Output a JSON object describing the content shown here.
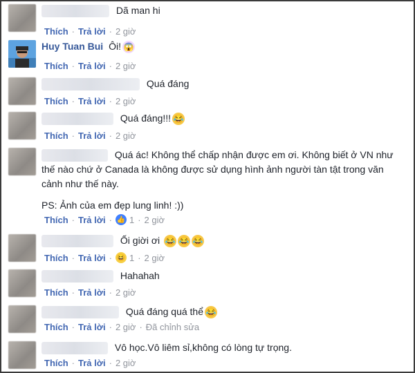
{
  "actions": {
    "like": "Thích",
    "reply": "Trả lời",
    "sep": "·"
  },
  "comments": [
    {
      "text": "Dã man hi",
      "time": "2 giờ"
    },
    {
      "name": "Huy Tuan Bui",
      "text": "Ôi!",
      "time": "2 giờ"
    },
    {
      "text": "Quá đáng",
      "time": "2 giờ"
    },
    {
      "text": "Quá đáng!!!",
      "time": "2 giờ"
    },
    {
      "text": "Quá ác! Không thể chấp nhận được em ơi. Không biết ở VN như thế nào chứ ở Canada là không được sử dụng hình ảnh người tàn tật trong văn cảnh như thế này.",
      "text2": "PS: Ảnh của em đẹp lung linh! :))",
      "reactions": "1",
      "time": "2 giờ"
    },
    {
      "text": "Ối giời ơi",
      "reactions": "1",
      "time": "2 giờ"
    },
    {
      "text": "Hahahah",
      "time": "2 giờ"
    },
    {
      "text": "Quá đáng quá thể",
      "time": "2 giờ",
      "edited": "Đã chỉnh sửa"
    },
    {
      "text": "Vô học.Vô liêm sỉ,không có lòng tự trọng.",
      "time": "2 giờ"
    }
  ],
  "icons": {
    "haha": "laughing-emoji",
    "shock": "shocked-emoji",
    "like": "like-reaction",
    "haha_reaction": "haha-reaction"
  }
}
